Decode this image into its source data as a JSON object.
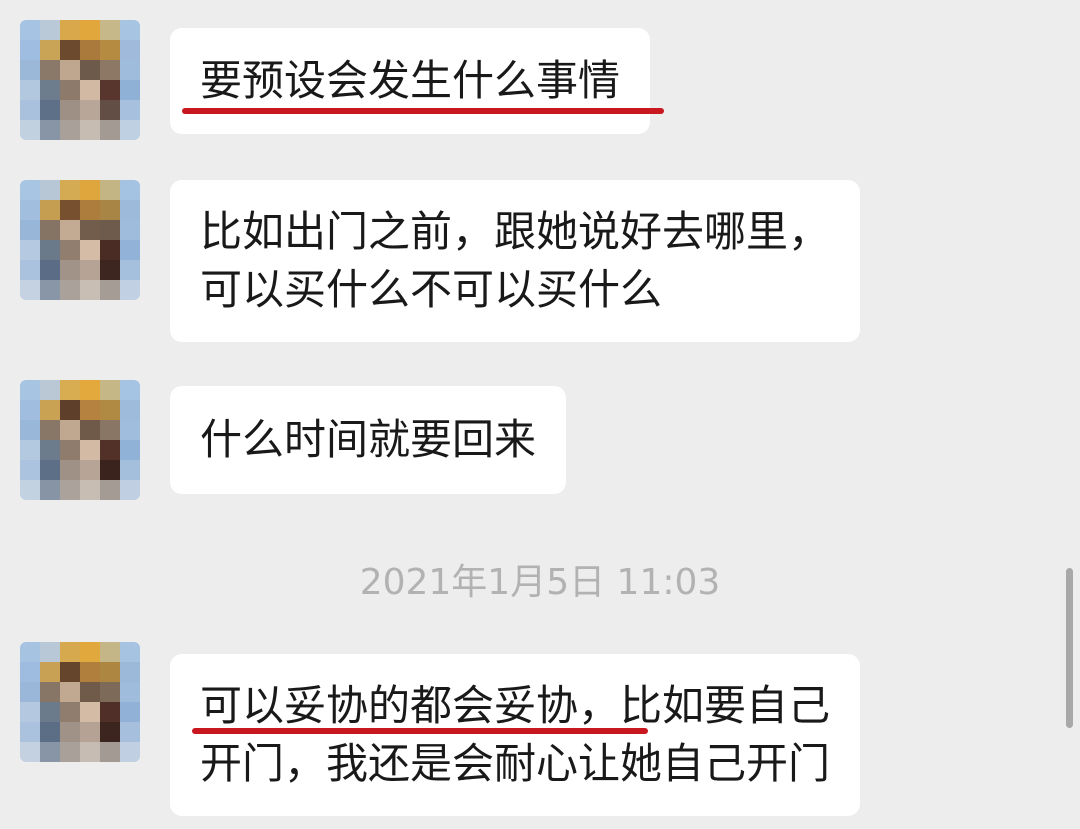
{
  "messages": [
    {
      "lines": [
        "要预设会发生什么事情"
      ]
    },
    {
      "lines": [
        "比如出门之前，跟她说好去哪里，",
        "可以买什么不可以买什么"
      ]
    },
    {
      "lines": [
        "什么时间就要回来"
      ]
    },
    {
      "lines": [
        "可以妥协的都会妥协，比如要自己",
        "开门，我还是会耐心让她自己开门"
      ]
    }
  ],
  "timestamp": "2021年1月5日 11:03",
  "colors": {
    "background": "#ededed",
    "bubble": "#ffffff",
    "text": "#191919",
    "timestamp": "#b2b2b2",
    "underline": "#c8171e"
  },
  "icons": {
    "avatar": "pixelated-avatar-icon",
    "scrollbar": "scrollbar-thumb"
  }
}
